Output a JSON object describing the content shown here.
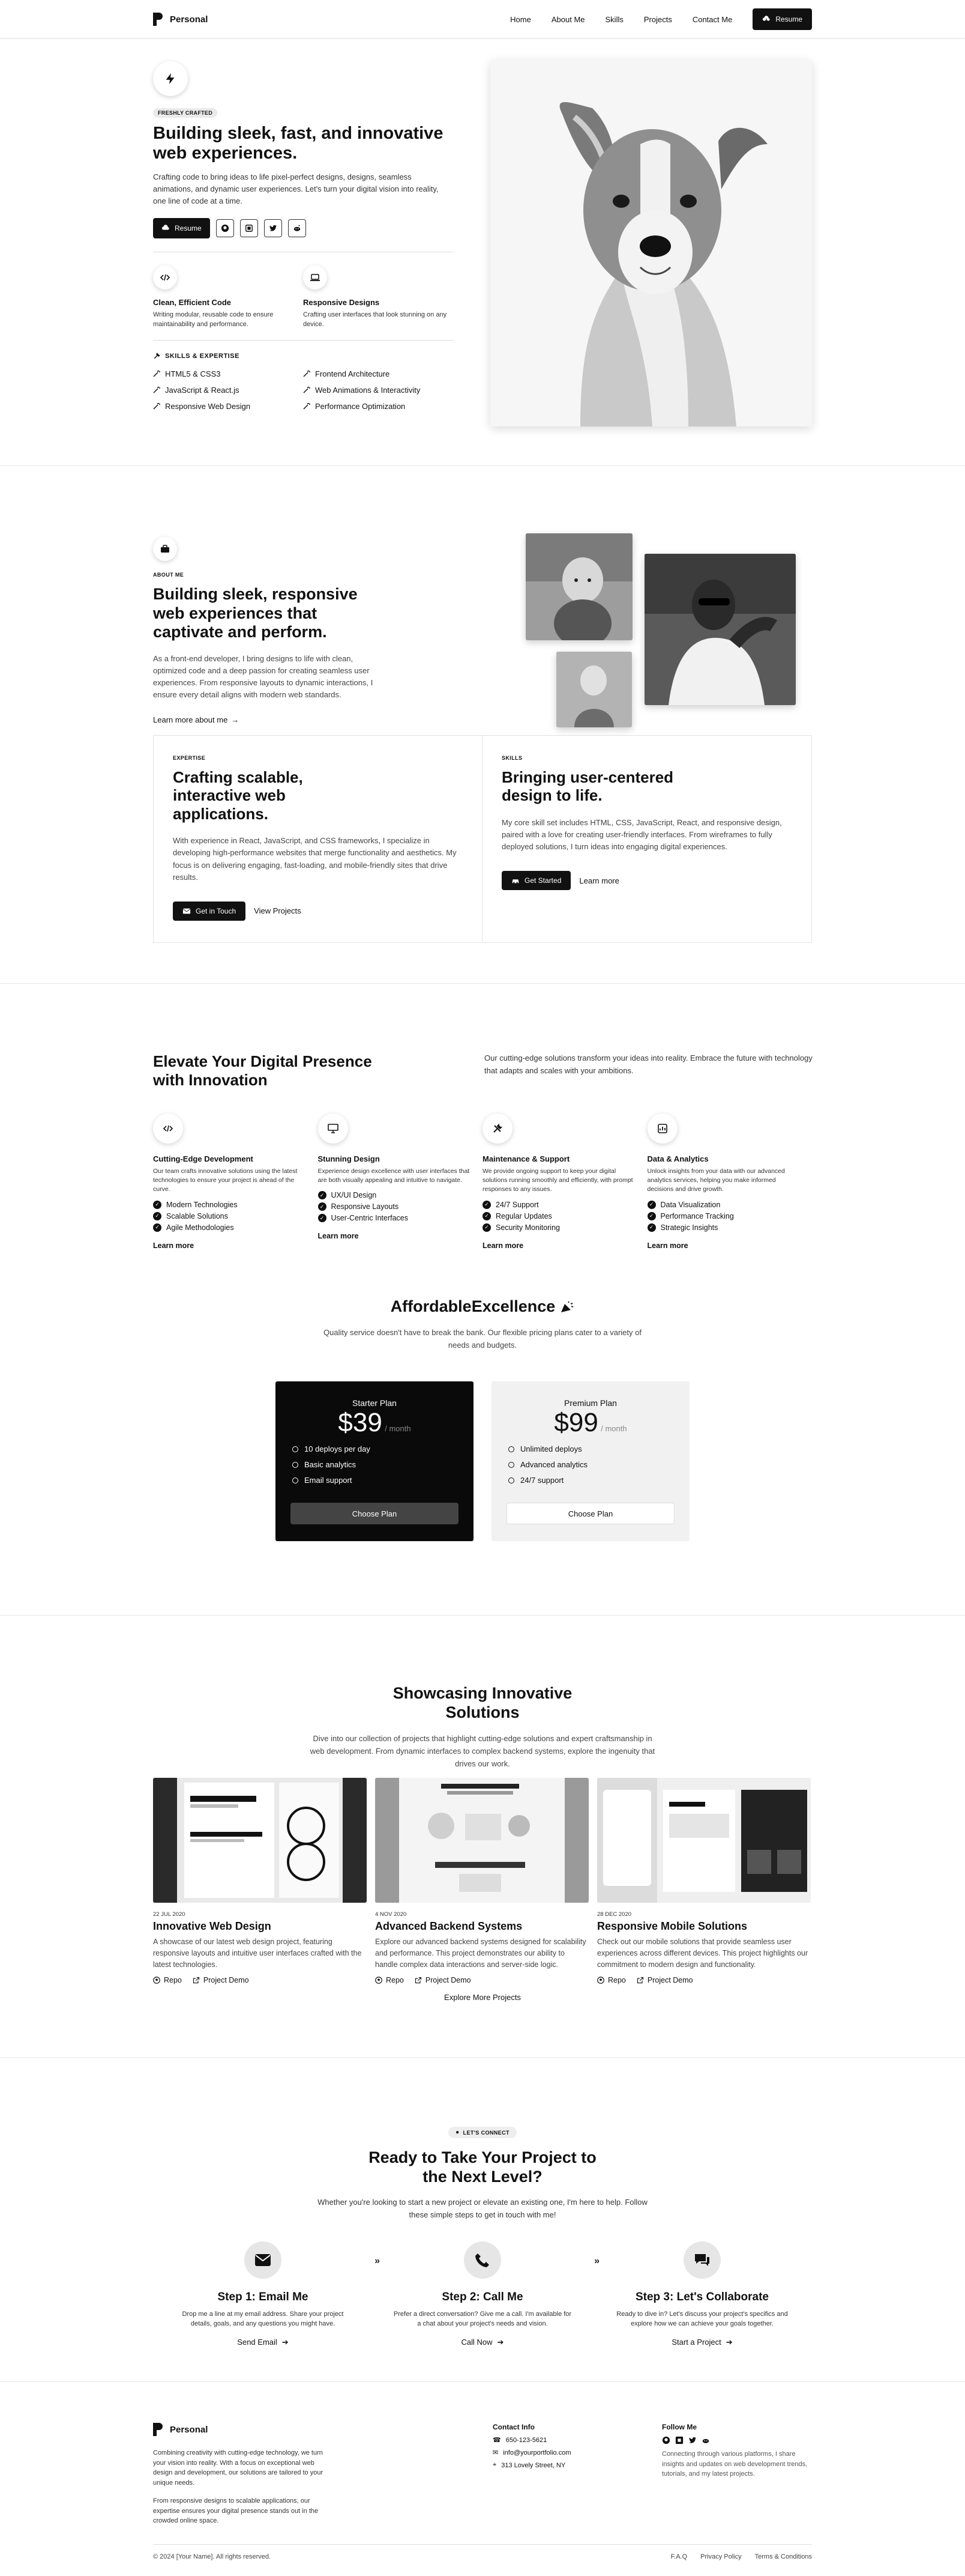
{
  "nav": {
    "brand": "Personal",
    "links": [
      "Home",
      "About Me",
      "Skills",
      "Projects",
      "Contact Me"
    ],
    "resume_label": "Resume"
  },
  "hero": {
    "tag": "FRESHLY CRAFTED",
    "title": "Building sleek, fast, and innovative web experiences.",
    "description": "Crafting code to bring ideas to life pixel-perfect designs, designs, seamless animations, and dynamic user experiences. Let's turn your digital vision into reality, one line of code at a time.",
    "resume_label": "Resume",
    "features": [
      {
        "title": "Clean, Efficient Code",
        "desc": "Writing modular, reusable code to ensure maintainability and performance."
      },
      {
        "title": "Responsive Designs",
        "desc": "Crafting user interfaces that look stunning on any device."
      }
    ],
    "skills_heading": "SKILLS & EXPERTISE",
    "skills": [
      "HTML5 & CSS3",
      "Frontend Architecture",
      "JavaScript & React.js",
      "Web Animations & Interactivity",
      "Responsive Web Design",
      "Performance Optimization"
    ]
  },
  "about": {
    "tag": "ABOUT ME",
    "title": "Building sleek, responsive web experiences that captivate and perform.",
    "description": "As a front-end developer, I bring designs to life with clean, optimized code and a deep passion for creating seamless user experiences. From responsive layouts to dynamic interactions, I ensure every detail aligns with modern web standards.",
    "link": "Learn more about me",
    "cards": [
      {
        "tag": "EXPERTISE",
        "title": "Crafting scalable, interactive web applications.",
        "desc": "With experience in React, JavaScript, and CSS frameworks, I specialize in developing high-performance websites that merge functionality and aesthetics. My focus is on delivering engaging, fast-loading, and mobile-friendly sites that drive results.",
        "primary": "Get in Touch",
        "secondary": "View Projects"
      },
      {
        "tag": "SKILLS",
        "title": "Bringing user-centered design to life.",
        "desc": "My core skill set includes HTML, CSS, JavaScript, React, and responsive design, paired with a love for creating user-friendly interfaces. From wireframes to fully deployed solutions, I turn ideas into engaging digital experiences.",
        "primary": "Get Started",
        "secondary": "Learn more"
      }
    ]
  },
  "services": {
    "title": "Elevate Your Digital Presence with Innovation",
    "intro": "Our cutting-edge solutions transform your ideas into reality. Embrace the future with technology that adapts and scales with your ambitions.",
    "items": [
      {
        "title": "Cutting-Edge Development",
        "desc": "Our team crafts innovative solutions using the latest technologies to ensure your project is ahead of the curve.",
        "points": [
          "Modern Technologies",
          "Scalable Solutions",
          "Agile Methodologies"
        ],
        "link": "Learn more"
      },
      {
        "title": "Stunning Design",
        "desc": "Experience design excellence with user interfaces that are both visually appealing and intuitive to navigate.",
        "points": [
          "UX/UI Design",
          "Responsive Layouts",
          "User-Centric Interfaces"
        ],
        "link": "Learn more"
      },
      {
        "title": "Maintenance & Support",
        "desc": "We provide ongoing support to keep your digital solutions running smoothly and efficiently, with prompt responses to any issues.",
        "points": [
          "24/7 Support",
          "Regular Updates",
          "Security Monitoring"
        ],
        "link": "Learn more"
      },
      {
        "title": "Data & Analytics",
        "desc": "Unlock insights from your data with our advanced analytics services, helping you make informed decisions and drive growth.",
        "points": [
          "Data Visualization",
          "Performance Tracking",
          "Strategic Insights"
        ],
        "link": "Learn more"
      }
    ],
    "pricing_title": "AffordableExcellence",
    "pricing_desc": "Quality service doesn't have to break the bank. Our flexible pricing plans cater to a variety of needs and budgets.",
    "plans": [
      {
        "name": "Starter Plan",
        "price": "$39",
        "period": "/ month",
        "features": [
          "10 deploys per day",
          "Basic analytics",
          "Email support"
        ],
        "cta": "Choose Plan"
      },
      {
        "name": "Premium Plan",
        "price": "$99",
        "period": "/ month",
        "features": [
          "Unlimited deploys",
          "Advanced analytics",
          "24/7 support"
        ],
        "cta": "Choose Plan"
      }
    ]
  },
  "projects": {
    "title": "Showcasing Innovative Solutions",
    "intro": "Dive into our collection of projects that highlight cutting-edge solutions and expert craftsmanship in web development. From dynamic interfaces to complex backend systems, explore the ingenuity that drives our work.",
    "items": [
      {
        "date": "22 JUL 2020",
        "title": "Innovative Web Design",
        "desc": "A showcase of our latest web design project, featuring responsive layouts and intuitive user interfaces crafted with the latest technologies.",
        "repo": "Repo",
        "demo": "Project Demo"
      },
      {
        "date": "4 NOV 2020",
        "title": "Advanced Backend Systems",
        "desc": "Explore our advanced backend systems designed for scalability and performance. This project demonstrates our ability to handle complex data interactions and server-side logic.",
        "repo": "Repo",
        "demo": "Project Demo"
      },
      {
        "date": "28 DEC 2020",
        "title": "Responsive Mobile Solutions",
        "desc": "Check out our mobile solutions that provide seamless user experiences across different devices. This project highlights our commitment to modern design and functionality.",
        "repo": "Repo",
        "demo": "Project Demo"
      }
    ],
    "explore": "Explore More Projects"
  },
  "contact": {
    "pill": "LET'S CONNECT",
    "title": "Ready to Take Your Project to the Next Level?",
    "intro": "Whether you're looking to start a new project or elevate an existing one, I'm here to help. Follow these simple steps to get in touch with me!",
    "steps": [
      {
        "title": "Step 1: Email Me",
        "desc": "Drop me a line at my email address. Share your project details, goals, and any questions you might have.",
        "link": "Send Email"
      },
      {
        "title": "Step 2: Call Me",
        "desc": "Prefer a direct conversation? Give me a call. I'm available for a chat about your project's needs and vision.",
        "link": "Call Now"
      },
      {
        "title": "Step 3: Let's Collaborate",
        "desc": "Ready to dive in? Let's discuss your project's specifics and explore how we can achieve your goals together.",
        "link": "Start a Project"
      }
    ]
  },
  "footer": {
    "brand": "Personal",
    "desc1": "Combining creativity with cutting-edge technology, we turn your vision into reality. With a focus on exceptional web design and development, our solutions are tailored to your unique needs.",
    "desc2": "From responsive designs to scalable applications, our expertise ensures your digital presence stands out in the crowded online space.",
    "contact_heading": "Contact Info",
    "phone": "650-123-5621",
    "email": "info@yourportfolio.com",
    "address": "313 Lovely Street, NY",
    "follow_heading": "Follow Me",
    "follow_desc": "Connecting through various platforms, I share insights and updates on web development trends, tutorials, and my latest projects.",
    "copyright": "© 2024 [Your Name]. All rights reserved.",
    "legal": [
      "F.A.Q",
      "Privacy Policy",
      "Terms & Conditions"
    ]
  }
}
